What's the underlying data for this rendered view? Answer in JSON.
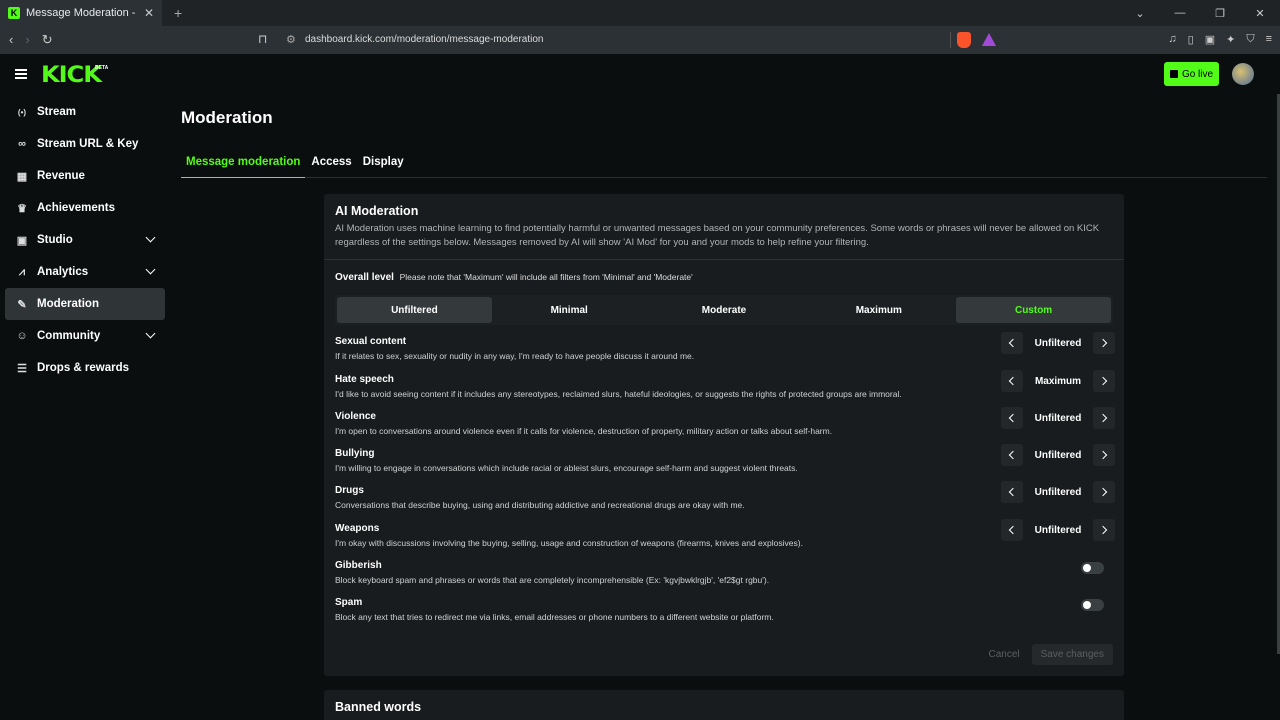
{
  "browser": {
    "tab_title": "Message Moderation - Kick Das",
    "new_tab": "+",
    "url": "dashboard.kick.com/moderation/message-moderation",
    "window_controls": [
      "⌄",
      "—",
      "❐",
      "✕"
    ]
  },
  "header": {
    "logo": "KICK",
    "logo_badge": "BETA",
    "go_live_label": "Go live"
  },
  "sidebar": {
    "items": [
      {
        "label": "Stream",
        "icon": "broadcast-icon",
        "glyph": "((·))"
      },
      {
        "label": "Stream URL & Key",
        "icon": "link-icon",
        "glyph": "⚭"
      },
      {
        "label": "Revenue",
        "icon": "revenue-icon",
        "glyph": "▦"
      },
      {
        "label": "Achievements",
        "icon": "trophy-icon",
        "glyph": "🏆"
      },
      {
        "label": "Studio",
        "icon": "studio-icon",
        "glyph": "▣"
      },
      {
        "label": "Analytics",
        "icon": "analytics-icon",
        "glyph": "📈"
      },
      {
        "label": "Moderation",
        "icon": "wrench-icon",
        "glyph": "🔧"
      },
      {
        "label": "Community",
        "icon": "community-icon",
        "glyph": "👥"
      },
      {
        "label": "Drops & rewards",
        "icon": "drops-icon",
        "glyph": "⛁"
      }
    ]
  },
  "main": {
    "title": "Moderation",
    "tabs": [
      "Message moderation",
      "Access",
      "Display"
    ],
    "ai": {
      "title": "AI Moderation",
      "description": "AI Moderation uses machine learning to find potentially harmful or unwanted messages based on your community preferences. Some words or phrases will never be allowed on KICK regardless of the settings below. Messages removed by AI will show 'AI Mod' for you and your mods to help refine your filtering.",
      "overall_label": "Overall level",
      "overall_note": "Please note that 'Maximum' will include all filters from 'Minimal' and 'Moderate'",
      "levels": [
        "Unfiltered",
        "Minimal",
        "Moderate",
        "Maximum",
        "Custom"
      ],
      "filters": [
        {
          "name": "Sexual content",
          "desc": "If it relates to sex, sexuality or nudity in any way, I'm ready to have people discuss it around me.",
          "value": "Unfiltered"
        },
        {
          "name": "Hate speech",
          "desc": "I'd like to avoid seeing content if it includes any stereotypes, reclaimed slurs, hateful ideologies, or suggests the rights of protected groups are immoral.",
          "value": "Maximum"
        },
        {
          "name": "Violence",
          "desc": "I'm open to conversations around violence even if it calls for violence, destruction of property, military action or talks about self-harm.",
          "value": "Unfiltered"
        },
        {
          "name": "Bullying",
          "desc": "I'm willing to engage in conversations which include racial or ableist slurs, encourage self-harm and suggest violent threats.",
          "value": "Unfiltered"
        },
        {
          "name": "Drugs",
          "desc": "Conversations that describe buying, using and distributing addictive and recreational drugs are okay with me.",
          "value": "Unfiltered"
        },
        {
          "name": "Weapons",
          "desc": "I'm okay with discussions involving the buying, selling, usage and construction of weapons (firearms, knives and explosives).",
          "value": "Unfiltered"
        }
      ],
      "toggles": [
        {
          "name": "Gibberish",
          "desc": "Block keyboard spam and phrases or words that are completely incomprehensible (Ex: 'kgvjbwklrgjb', 'ef2$gt rgbu')."
        },
        {
          "name": "Spam",
          "desc": "Block any text that tries to redirect me via links, email addresses or phone numbers to a different website or platform."
        }
      ],
      "cancel_label": "Cancel",
      "save_label": "Save changes"
    },
    "banned_words_title": "Banned words"
  },
  "colors": {
    "accent": "#53fc18",
    "bg": "#0b0e0f",
    "card": "#181c1e"
  }
}
